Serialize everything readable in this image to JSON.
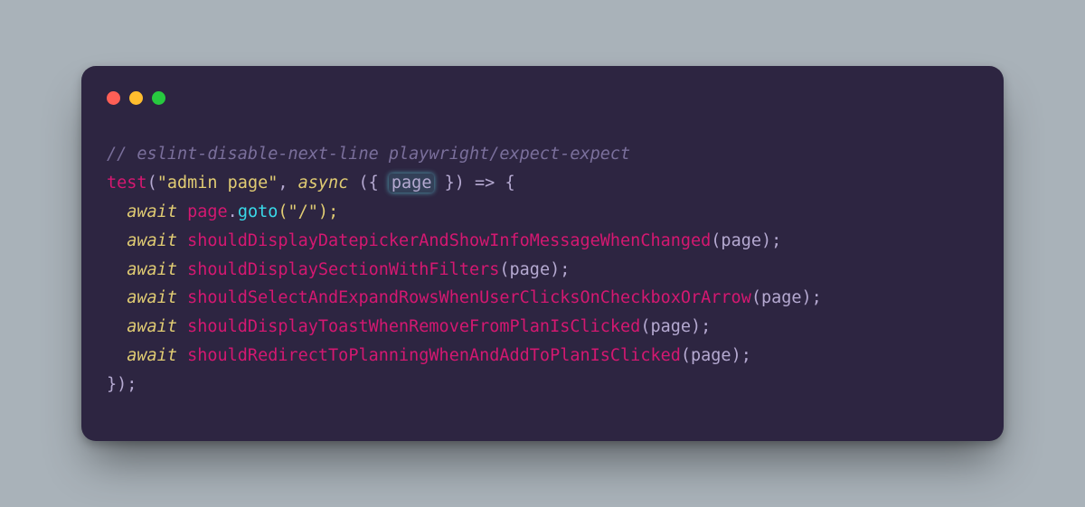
{
  "code": {
    "comment": "// eslint-disable-next-line playwright/expect-expect",
    "test_fn": "test",
    "test_name_quoted": "\"admin page\"",
    "comma_space": ", ",
    "async": "async",
    "params_open": " ({ ",
    "param_page": "page",
    "params_close": " }) ",
    "arrow_brace": "=> {",
    "await": "await",
    "page_ident": "page",
    "dot": ".",
    "goto": "goto",
    "goto_arg": "(\"/\");",
    "calls": [
      {
        "name": "shouldDisplayDatepickerAndShowInfoMessageWhenChanged"
      },
      {
        "name": "shouldDisplaySectionWithFilters"
      },
      {
        "name": "shouldSelectAndExpandRowsWhenUserClicksOnCheckboxOrArrow"
      },
      {
        "name": "shouldDisplayToastWhenRemoveFromPlanIsClicked"
      },
      {
        "name": "shouldRedirectToPlanningWhenAndAddToPlanIsClicked"
      }
    ],
    "call_args": "(page);",
    "close": "});"
  }
}
